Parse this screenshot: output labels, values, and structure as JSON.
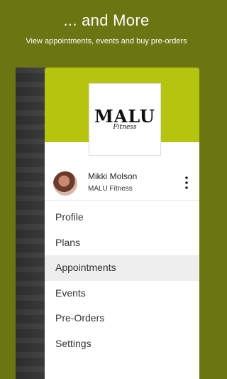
{
  "promo": {
    "title": "... and More",
    "subtitle": "View appointments, events and buy pre-orders"
  },
  "drawer": {
    "logo": {
      "main": "MALU",
      "sub": "Fitness"
    },
    "user": {
      "name": "Mikki Molson",
      "org": "MALU Fitness"
    },
    "menu": [
      {
        "label": "Profile",
        "active": false
      },
      {
        "label": "Plans",
        "active": false
      },
      {
        "label": "Appointments",
        "active": true
      },
      {
        "label": "Events",
        "active": false
      },
      {
        "label": "Pre-Orders",
        "active": false
      },
      {
        "label": "Settings",
        "active": false
      }
    ]
  },
  "colors": {
    "background": "#6b7512",
    "header": "#b5c40f",
    "active_item": "#eeeeee"
  }
}
